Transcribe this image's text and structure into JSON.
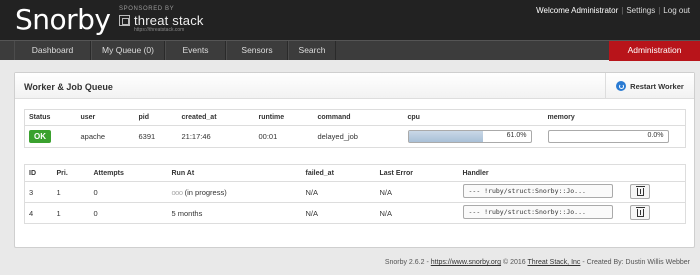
{
  "header": {
    "logo": "Snorby",
    "sponsor_label": "SPONSORED BY",
    "sponsor_name": "threat stack",
    "sponsor_url": "https://threatstack.com",
    "welcome": "Welcome Administrator",
    "settings": "Settings",
    "logout": "Log out",
    "separator": "|"
  },
  "nav": {
    "items": [
      "Dashboard",
      "My Queue (0)",
      "Events",
      "Sensors",
      "Search"
    ],
    "admin": "Administration"
  },
  "panel": {
    "title": "Worker & Job Queue",
    "restart_label": "Restart Worker"
  },
  "worker": {
    "headers": [
      "Status",
      "user",
      "pid",
      "created_at",
      "runtime",
      "command",
      "cpu",
      "memory"
    ],
    "status": "OK",
    "user": "apache",
    "pid": "6391",
    "created_at": "21:17:46",
    "runtime": "00:01",
    "command": "delayed_job",
    "cpu_label": "61.0%",
    "cpu_value": 0.61,
    "memory_label": "0.0%",
    "memory_value": 0.0,
    "status_color": "#3aa12e"
  },
  "jobs": {
    "headers": [
      "ID",
      "Pri.",
      "Attempts",
      "Run At",
      "failed_at",
      "Last Error",
      "Handler"
    ],
    "rows": [
      {
        "id": "3",
        "pri": "1",
        "attempts": "0",
        "run_at_icon": "ooo",
        "run_at": "(in progress)",
        "failed_at": "N/A",
        "last_error": "N/A",
        "handler": "--- !ruby/struct:Snorby::Jo..."
      },
      {
        "id": "4",
        "pri": "1",
        "attempts": "0",
        "run_at_icon": "",
        "run_at": "5 months",
        "failed_at": "N/A",
        "last_error": "N/A",
        "handler": "--- !ruby/struct:Snorby::Jo..."
      }
    ]
  },
  "footer": {
    "version": "Snorby 2.6.2 -",
    "site": "https://www.snorby.org",
    "copyright": "© 2016",
    "company": "Threat Stack, Inc",
    "credit": "- Created By: Dustin Willis Webber"
  },
  "colors": {
    "admin_tab": "#b8141a",
    "topbar": "#222222",
    "navbar": "#3c3c3c"
  }
}
